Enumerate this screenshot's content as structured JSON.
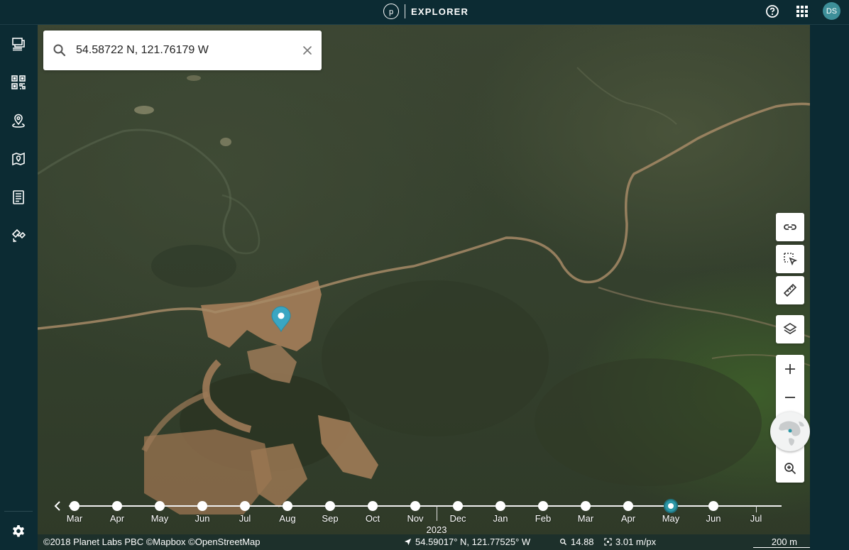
{
  "header": {
    "brand_letter": "p",
    "title": "EXPLORER",
    "user_initials": "DS"
  },
  "left_sidebar": {
    "items": [
      {
        "icon": "layers-stack-icon"
      },
      {
        "icon": "grid-mosaic-icon"
      },
      {
        "icon": "location-pin-icon"
      },
      {
        "icon": "map-pin-icon"
      },
      {
        "icon": "document-list-icon"
      },
      {
        "icon": "satellite-tasking-icon"
      }
    ],
    "settings_icon": "gear-icon"
  },
  "right_sidebar": {
    "items": [
      {
        "icon": "compare-swipe-icon"
      },
      {
        "icon": "analysis-sparkle-icon"
      },
      {
        "icon": "terrain-icon"
      },
      {
        "icon": "contrast-icon"
      }
    ]
  },
  "search": {
    "value": "54.58722 N, 121.76179 W",
    "placeholder": "Search"
  },
  "map_tools": [
    "link-icon",
    "select-area-icon",
    "ruler-icon",
    "layers-icon"
  ],
  "zoom": {
    "in": "+",
    "out": "−"
  },
  "timeline": {
    "months": [
      "Mar",
      "Apr",
      "May",
      "Jun",
      "Jul",
      "Aug",
      "Sep",
      "Oct",
      "Nov",
      "Dec",
      "Jan",
      "Feb",
      "Mar",
      "Apr",
      "May",
      "Jun",
      "Jul"
    ],
    "year_label": "2023",
    "active_month_index": 14
  },
  "status": {
    "attribution": "©2018 Planet Labs PBC ©Mapbox ©OpenStreetMap",
    "cursor_coords": "54.59017° N, 121.77525° W",
    "zoom_level": "14.88",
    "resolution": "3.01 m/px",
    "scale": "200 m"
  },
  "colors": {
    "chrome": "#0c2b33",
    "accent": "#2c97a6",
    "marker": "#3aa6c2"
  }
}
